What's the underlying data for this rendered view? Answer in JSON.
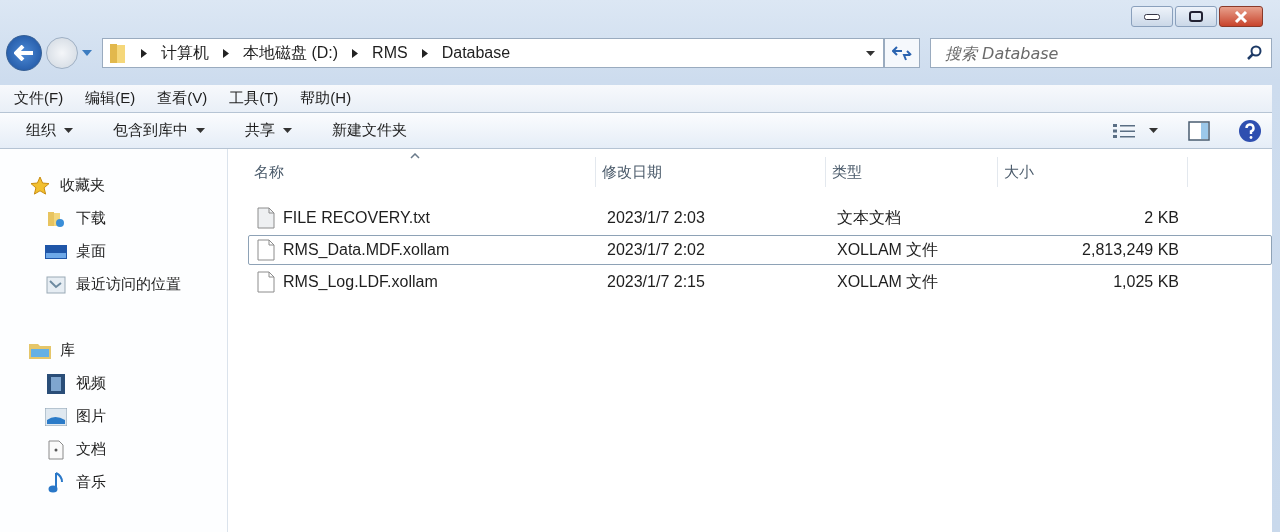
{
  "address": {
    "breadcrumbs": [
      "计算机",
      "本地磁盘 (D:)",
      "RMS",
      "Database"
    ]
  },
  "search": {
    "placeholder": "搜索 Database"
  },
  "menu": [
    "文件(F)",
    "编辑(E)",
    "查看(V)",
    "工具(T)",
    "帮助(H)"
  ],
  "toolbar": [
    {
      "label": "组织",
      "dropdown": true
    },
    {
      "label": "包含到库中",
      "dropdown": true
    },
    {
      "label": "共享",
      "dropdown": true
    },
    {
      "label": "新建文件夹",
      "dropdown": false
    }
  ],
  "sidebar": [
    {
      "label": "收藏夹",
      "children": [
        {
          "label": "下载"
        },
        {
          "label": "桌面"
        },
        {
          "label": "最近访问的位置"
        }
      ]
    },
    {
      "label": "库",
      "children": [
        {
          "label": "视频"
        },
        {
          "label": "图片"
        },
        {
          "label": "文档"
        },
        {
          "label": "音乐"
        }
      ]
    }
  ],
  "columns": [
    {
      "label": "名称",
      "sorted": true
    },
    {
      "label": "修改日期",
      "sorted": false
    },
    {
      "label": "类型",
      "sorted": false
    },
    {
      "label": "大小",
      "sorted": false
    }
  ],
  "rows": [
    {
      "name": "FILE RECOVERY.txt",
      "modified": "2023/1/7 2:03",
      "type": "文本文档",
      "size": "2 KB",
      "focused": false
    },
    {
      "name": "RMS_Data.MDF.xollam",
      "modified": "2023/1/7 2:02",
      "type": "XOLLAM 文件",
      "size": "2,813,249 KB",
      "focused": true
    },
    {
      "name": "RMS_Log.LDF.xollam",
      "modified": "2023/1/7 2:15",
      "type": "XOLLAM 文件",
      "size": "1,025 KB",
      "focused": false
    }
  ]
}
